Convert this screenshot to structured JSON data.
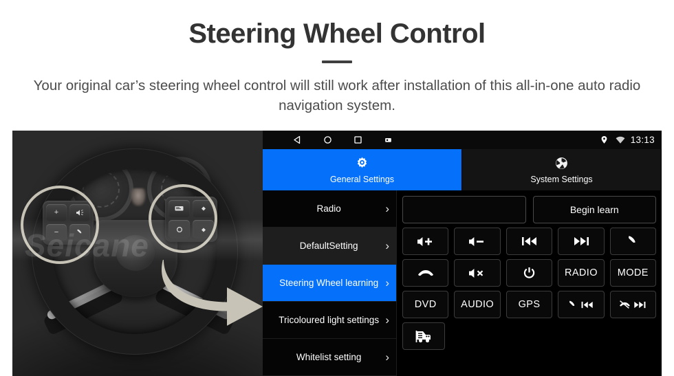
{
  "header": {
    "title": "Steering Wheel Control",
    "subtitle": "Your original car’s steering wheel control will still work after installation of this all-in-one auto radio navigation system."
  },
  "photo": {
    "alt": "steering-wheel-photo",
    "watermark": "Seicane"
  },
  "headunit": {
    "statusbar": {
      "back_icon": "back-triangle-icon",
      "home_icon": "home-circle-icon",
      "recents_icon": "recents-square-icon",
      "screenshot_icon": "screenshot-icon",
      "location_icon": "location-pin-icon",
      "wifi_icon": "wifi-icon",
      "time": "13:13"
    },
    "tabs": [
      {
        "label": "General Settings",
        "icon": "gear-icon",
        "active": true
      },
      {
        "label": "System Settings",
        "icon": "system-logo-icon",
        "active": false
      }
    ],
    "sidebar": [
      {
        "label": "Radio",
        "state": "normal"
      },
      {
        "label": "DefaultSetting",
        "state": "dim"
      },
      {
        "label": "Steering Wheel learning",
        "state": "active"
      },
      {
        "label": "Tricoloured light settings",
        "state": "normal"
      },
      {
        "label": "Whitelist setting",
        "state": "normal"
      }
    ],
    "top_row": {
      "input_value": "",
      "begin_learn_label": "Begin learn"
    },
    "key_rows": [
      [
        {
          "label": "",
          "icon": "volume-up-icon"
        },
        {
          "label": "",
          "icon": "volume-down-icon"
        },
        {
          "label": "",
          "icon": "previous-track-icon"
        },
        {
          "label": "",
          "icon": "next-track-icon"
        },
        {
          "label": "",
          "icon": "phone-call-icon"
        }
      ],
      [
        {
          "label": "",
          "icon": "hang-up-icon"
        },
        {
          "label": "",
          "icon": "mute-icon"
        },
        {
          "label": "",
          "icon": "power-icon"
        },
        {
          "label": "RADIO",
          "icon": ""
        },
        {
          "label": "MODE",
          "icon": ""
        }
      ],
      [
        {
          "label": "DVD",
          "icon": ""
        },
        {
          "label": "AUDIO",
          "icon": ""
        },
        {
          "label": "GPS",
          "icon": ""
        },
        {
          "label": "",
          "icon": "phone-previous-icon"
        },
        {
          "label": "",
          "icon": "hangup-next-icon"
        }
      ],
      [
        {
          "label": "",
          "icon": "car-icon"
        }
      ]
    ]
  },
  "colors": {
    "accent_blue": "#0571fb",
    "highlight_yellow": "#f4c321",
    "arrow_yellow": "#f5c520",
    "title_gray": "#333333",
    "panel_black": "#000000"
  }
}
